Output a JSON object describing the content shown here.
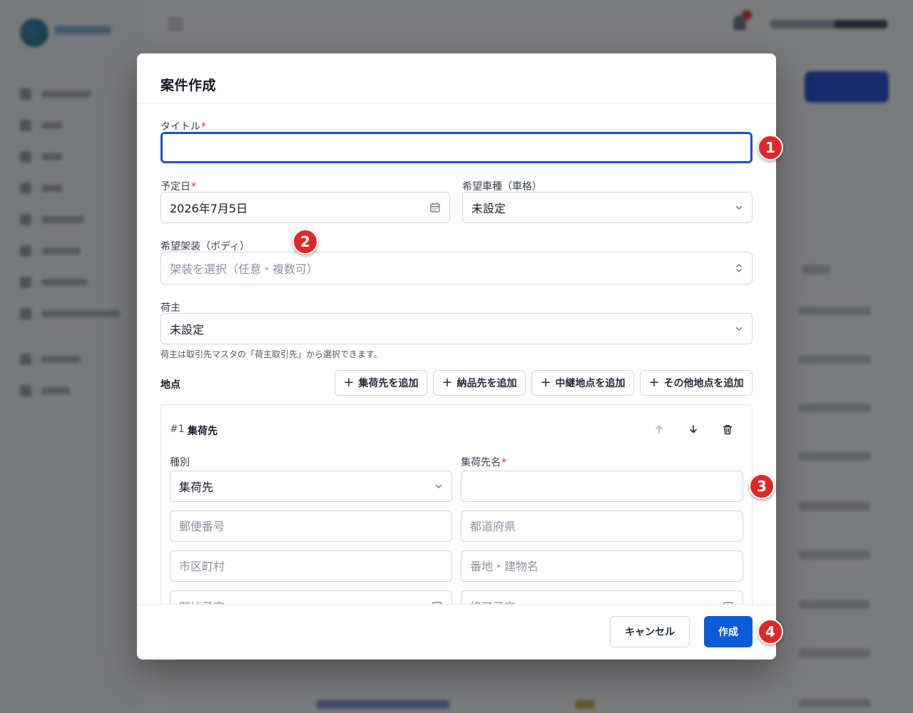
{
  "modal": {
    "title": "案件作成",
    "title_field": {
      "label": "タイトル",
      "required_mark": "*",
      "value": ""
    },
    "date_field": {
      "label": "予定日",
      "required_mark": "*",
      "value": "2026年7月5日"
    },
    "vehicle_field": {
      "label": "希望車種（車格）",
      "value": "未設定"
    },
    "body_field": {
      "label": "希望架装（ボディ）",
      "placeholder": "架装を選択（任意・複数可）"
    },
    "shipper_field": {
      "label": "荷主",
      "value": "未設定",
      "help": "荷主は取引先マスタの「荷主取引先」から選択できます。"
    },
    "points": {
      "label": "地点",
      "add_buttons": [
        "集荷先を追加",
        "納品先を追加",
        "中継地点を追加",
        "その他地点を追加"
      ],
      "items": [
        {
          "index": "#1",
          "type_title": "集荷先",
          "kind_label": "種別",
          "kind_value": "集荷先",
          "name_label": "集荷先名",
          "name_required_mark": "*",
          "name_value": "",
          "postal_placeholder": "郵便番号",
          "prefecture_placeholder": "都道府県",
          "city_placeholder": "市区町村",
          "address_placeholder": "番地・建物名",
          "start_placeholder": "開始予定",
          "end_placeholder": "終了予定"
        }
      ]
    },
    "footer": {
      "cancel_label": "キャンセル",
      "create_label": "作成"
    }
  },
  "markers": [
    "1",
    "2",
    "3",
    "4"
  ],
  "colors": {
    "primary": "#0b5bd8",
    "focus": "#1d4ed8",
    "required": "#dc2626",
    "marker": "#e12828"
  },
  "icons": {
    "date": "calendar-icon",
    "select": "chevron-down-icon",
    "multiselect": "chevron-up-down-icon",
    "add": "plus-icon",
    "move_up": "arrow-up-icon",
    "move_down": "arrow-down-icon",
    "delete": "trash-icon"
  }
}
